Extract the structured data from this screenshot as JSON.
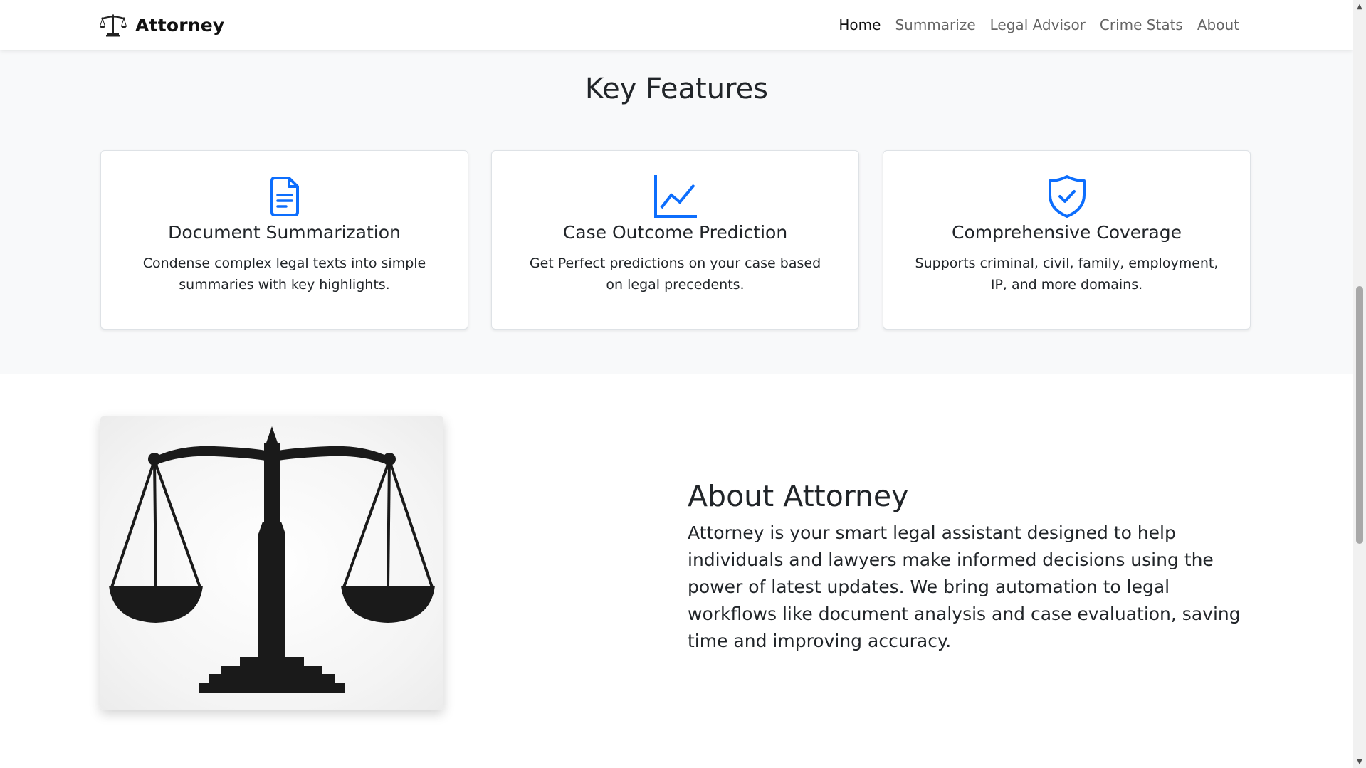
{
  "navbar": {
    "brand": "Attorney",
    "brand_icon": "scales-of-justice-icon",
    "links": [
      {
        "label": "Home",
        "active": true
      },
      {
        "label": "Summarize",
        "active": false
      },
      {
        "label": "Legal Advisor",
        "active": false
      },
      {
        "label": "Crime Stats",
        "active": false
      },
      {
        "label": "About",
        "active": false
      }
    ]
  },
  "features": {
    "title": "Key Features",
    "cards": [
      {
        "icon": "document-icon",
        "title": "Document Summarization",
        "text": "Condense complex legal texts into simple summaries with key highlights."
      },
      {
        "icon": "line-chart-icon",
        "title": "Case Outcome Prediction",
        "text": "Get Perfect predictions on your case based on legal precedents."
      },
      {
        "icon": "shield-check-icon",
        "title": "Comprehensive Coverage",
        "text": "Supports criminal, civil, family, employment, IP, and more domains."
      }
    ]
  },
  "about": {
    "image": "scales-of-justice-image",
    "title": "About Attorney",
    "text": "Attorney is your smart legal assistant designed to help individuals and lawyers make informed decisions using the power of latest updates. We bring automation to legal workflows like document analysis and case evaluation, saving time and improving accuracy."
  },
  "colors": {
    "accent": "#0d6efd",
    "section_bg": "#f8f9fa",
    "text": "#212529",
    "nav_inactive": "#666666"
  },
  "scrollbar": {
    "up_arrow": "▲",
    "down_arrow": "▼"
  }
}
